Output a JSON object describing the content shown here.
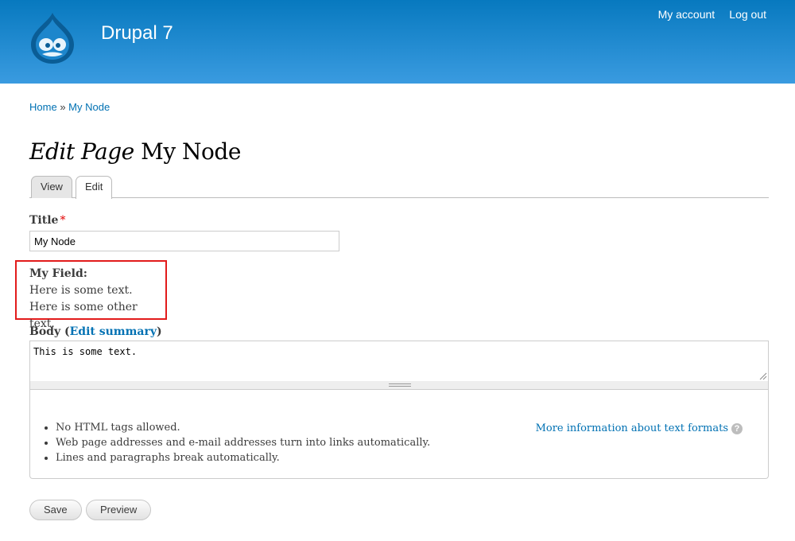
{
  "header": {
    "site_name": "Drupal 7",
    "menu": {
      "account": "My account",
      "logout": "Log out"
    }
  },
  "breadcrumb": {
    "home": "Home",
    "separator": "»",
    "current": "My Node"
  },
  "page_title": {
    "prefix": "Edit Page",
    "node_title": "My Node"
  },
  "tabs": {
    "view": "View",
    "edit": "Edit"
  },
  "form": {
    "title_label": "Title",
    "title_required": "*",
    "title_value": "My Node",
    "my_field": {
      "label": "My Field:",
      "items": [
        "Here is some text.",
        "Here is some other text."
      ]
    },
    "body_label": "Body",
    "body_summary_link": "Edit summary",
    "body_value": "This is some text.",
    "format_tips": [
      "No HTML tags allowed.",
      "Web page addresses and e-mail addresses turn into links automatically.",
      "Lines and paragraphs break automatically."
    ],
    "format_help_link": "More information about text formats",
    "help_icon_glyph": "?"
  },
  "buttons": {
    "save": "Save",
    "preview": "Preview"
  },
  "colors": {
    "header_top": "#0779bf",
    "header_bottom": "#3a9be0",
    "link": "#0071b3",
    "highlight_border": "#e21b1b",
    "required": "#e20000"
  },
  "icons": {
    "logo": "drupal-drop-logo",
    "help": "question-circle-icon",
    "resize": "resize-grip-icon"
  }
}
